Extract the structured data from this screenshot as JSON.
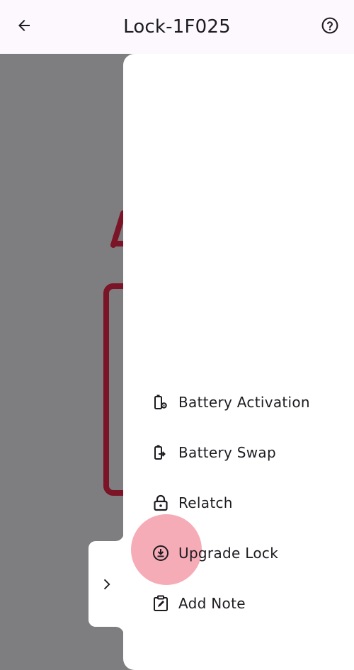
{
  "header": {
    "title": "Lock-1F025",
    "back_icon": "arrow-left-icon",
    "help_icon": "help-circle-icon"
  },
  "colors": {
    "scrim": "#7e7d80",
    "accent_dark_red": "#7a1426",
    "ripple": "#f5a8b3"
  },
  "menu": {
    "items": [
      {
        "label": "Battery Activation",
        "icon": "battery-gear-icon"
      },
      {
        "label": "Battery Swap",
        "icon": "battery-swap-icon"
      },
      {
        "label": "Relatch",
        "icon": "lock-icon"
      },
      {
        "label": "Upgrade Lock",
        "icon": "download-circle-icon"
      },
      {
        "label": "Add Note",
        "icon": "edit-note-icon"
      }
    ]
  },
  "drawer_toggle": {
    "icon": "chevron-right-icon"
  }
}
